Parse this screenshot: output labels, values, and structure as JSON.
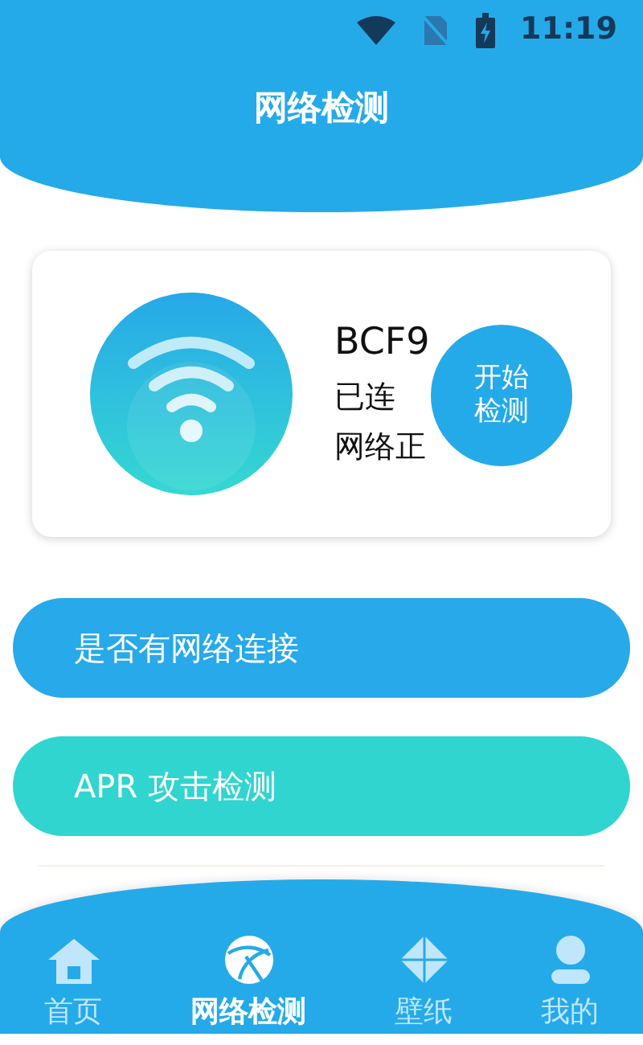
{
  "status_bar": {
    "time": "11:19"
  },
  "header": {
    "title": "网络检测"
  },
  "wifi_card": {
    "ssid": "BCF9",
    "connection": "已连",
    "network_status": "网络正",
    "action_button": "开始检测"
  },
  "actions": [
    {
      "label": "是否有网络连接",
      "color": "#27a9ea"
    },
    {
      "label": "APR 攻击检测",
      "color": "#30d5cf"
    }
  ],
  "bottom_nav": [
    {
      "label": "首页",
      "kind": "home",
      "selected": false
    },
    {
      "label": "网络检测",
      "kind": "globe",
      "selected": true
    },
    {
      "label": "壁纸",
      "kind": "diamond",
      "selected": false
    },
    {
      "label": "我的",
      "kind": "person",
      "selected": false
    }
  ]
}
